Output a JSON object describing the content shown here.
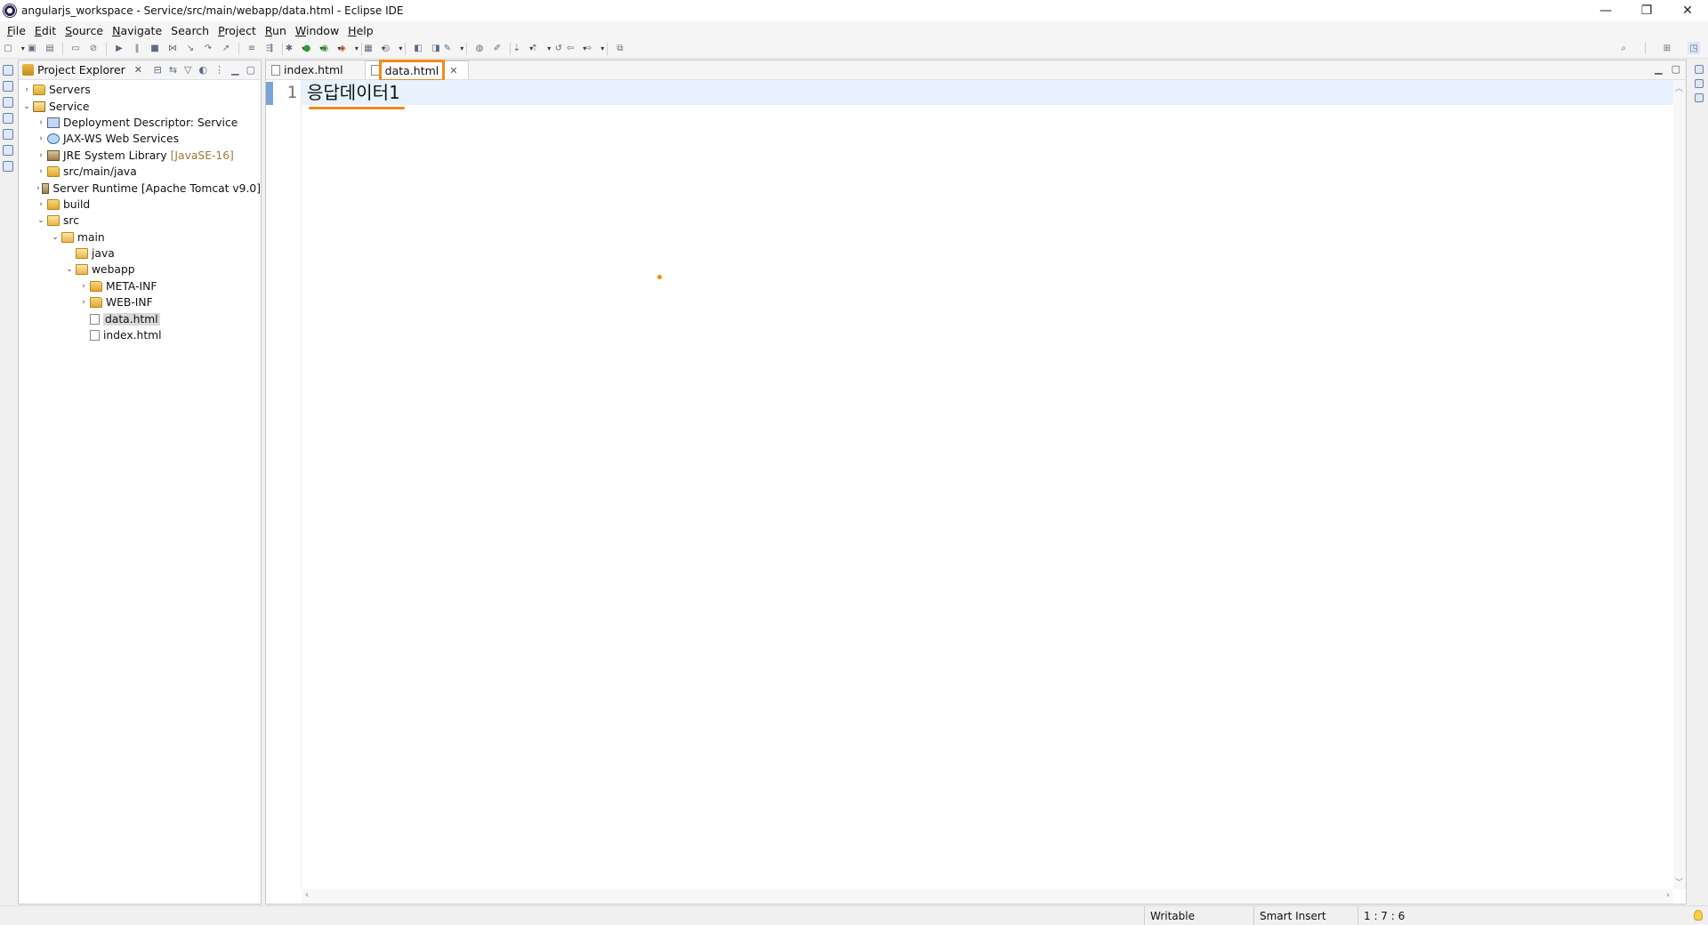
{
  "window": {
    "title": "angularjs_workspace - Service/src/main/webapp/data.html - Eclipse IDE",
    "controls": {
      "minimize": "—",
      "restore": "❐",
      "close": "✕"
    }
  },
  "menu": [
    {
      "label": "File",
      "mnemonic": "F",
      "rest": "ile"
    },
    {
      "label": "Edit",
      "mnemonic": "E",
      "rest": "dit"
    },
    {
      "label": "Source",
      "mnemonic": "S",
      "rest": "ource"
    },
    {
      "label": "Navigate",
      "mnemonic": "N",
      "rest": "avigate"
    },
    {
      "label": "Search",
      "mnemonic": "",
      "rest": "Search"
    },
    {
      "label": "Project",
      "mnemonic": "P",
      "rest": "roject"
    },
    {
      "label": "Run",
      "mnemonic": "R",
      "rest": "un"
    },
    {
      "label": "Window",
      "mnemonic": "W",
      "rest": "indow"
    },
    {
      "label": "Help",
      "mnemonic": "H",
      "rest": "elp"
    }
  ],
  "explorer": {
    "tab_label": "Project Explorer",
    "tree": [
      {
        "label": "Servers",
        "expanded": false,
        "icon": "folder-icon"
      },
      {
        "label": "Service",
        "expanded": true,
        "icon": "project-icon"
      },
      {
        "label": "Deployment Descriptor: Service",
        "expanded": false,
        "icon": "descriptor-icon"
      },
      {
        "label": "JAX-WS Web Services",
        "expanded": false,
        "icon": "web-services-icon"
      },
      {
        "label": "JRE System Library",
        "suffix": "[JavaSE-16]",
        "expanded": false,
        "icon": "library-icon"
      },
      {
        "label": "src/main/java",
        "expanded": false,
        "icon": "source-folder-icon"
      },
      {
        "label": "Server Runtime [Apache Tomcat v9.0]",
        "expanded": false,
        "icon": "library-icon"
      },
      {
        "label": "build",
        "expanded": false,
        "icon": "folder-icon"
      },
      {
        "label": "src",
        "expanded": true,
        "icon": "open-folder-icon"
      },
      {
        "label": "main",
        "expanded": true,
        "icon": "open-folder-icon"
      },
      {
        "label": "java",
        "icon": "open-folder-icon"
      },
      {
        "label": "webapp",
        "expanded": true,
        "icon": "open-folder-icon"
      },
      {
        "label": "META-INF",
        "expanded": false,
        "icon": "folder-icon"
      },
      {
        "label": "WEB-INF",
        "expanded": false,
        "icon": "folder-icon"
      },
      {
        "label": "data.html",
        "selected": true,
        "icon": "html-file-icon"
      },
      {
        "label": "index.html",
        "icon": "html-file-icon"
      }
    ]
  },
  "editor": {
    "tabs": [
      {
        "label": "index.html",
        "active": false
      },
      {
        "label": "data.html",
        "active": true
      }
    ],
    "lines": [
      {
        "number": "1",
        "text": "응답데이터1"
      }
    ]
  },
  "status": {
    "writable": "Writable",
    "insert_mode": "Smart Insert",
    "position": "1 : 7 : 6"
  },
  "colors": {
    "highlight": "#f28a1b",
    "current_line": "#e8f2fe",
    "selection": "#d9d9d9"
  }
}
